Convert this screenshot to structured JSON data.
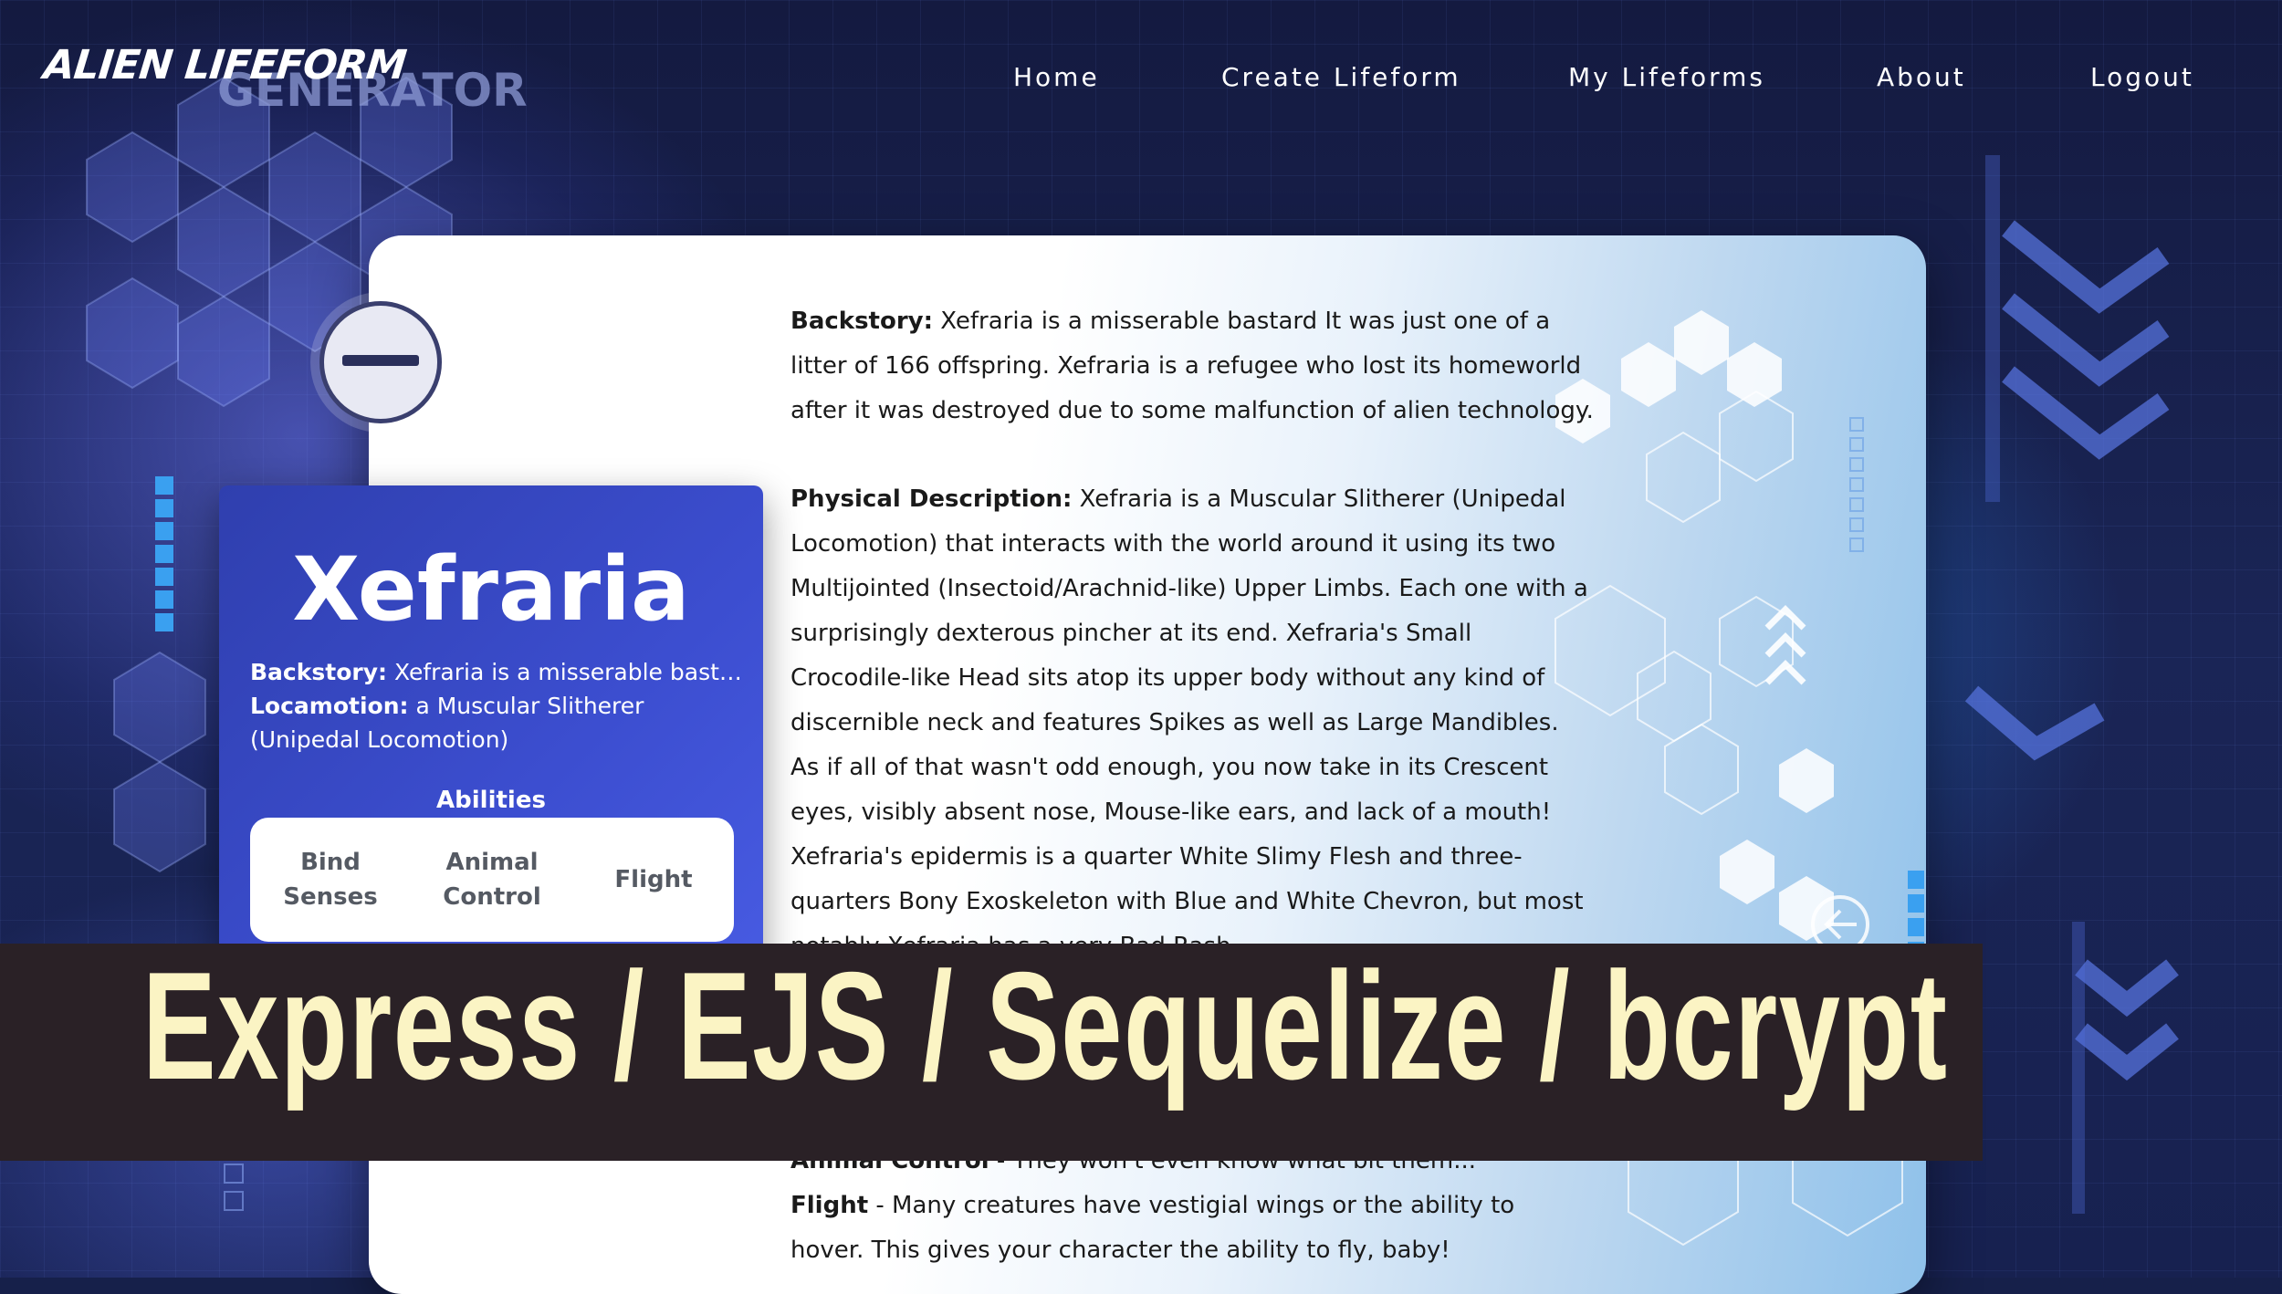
{
  "brand": {
    "line1": "ALIEN LIFEFORM",
    "line2": "GENERATOR"
  },
  "nav": {
    "home": "Home",
    "create": "Create Lifeform",
    "my": "My Lifeforms",
    "about": "About",
    "logout": "Logout"
  },
  "profile": {
    "name": "Xefraria",
    "backstory_label": "Backstory:",
    "backstory_short": "Xefraria is a misserable bastar...",
    "locomotion_label": "Locamotion:",
    "locomotion": "a Muscular Slitherer (Unipedal Locomotion)",
    "abilities_title": "Abilities",
    "abilities": [
      "Bind Senses",
      "Animal Control",
      "Flight"
    ]
  },
  "details": {
    "backstory_label": "Backstory:",
    "backstory": "Xefraria is a misserable bastard It was just one of a litter of 166 offspring. Xefraria is a refugee who lost its homeworld after it was destroyed due to some malfunction of alien technology.",
    "physical_label": "Physical Description:",
    "physical": "Xefraria is a Muscular Slitherer (Unipedal Locomotion) that interacts with the world around it using its two Multijointed (Insectoid/Arachnid-like) Upper Limbs. Each one with a surprisingly dexterous pincher at its end. Xefraria's Small Crocodile-like Head sits atop its upper body without any kind of discernible neck and features Spikes as well as Large Mandibles. As if all of that wasn't odd enough, you now take in its Crescent eyes, visibly absent nose, Mouse-like ears, and lack of a mouth! Xefraria's epidermis is a quarter White Slimy Flesh and three-quarters Bony Exoskeleton with Blue and White Chevron, but most notably Xefraria has a very Bad Rash.",
    "animal_label": "Animal Control",
    "animal": " - They won't even know what bit them...",
    "flight_label": "Flight",
    "flight": " - Many creatures have vestigial wings or the ability to hover. This gives your character the ability to fly, baby!"
  },
  "banner": {
    "text": "Express / EJS / Sequelize / bcrypt"
  },
  "colors": {
    "background": "#16204a",
    "profile_card": "#3c4ed0",
    "banner_bg": "#2a2126",
    "banner_text": "#fbf4c4",
    "accent_blue": "#3aa0f0"
  },
  "icons": [
    "circle-minus-icon",
    "arrow-left-circle-icon",
    "chevron-up-icon"
  ]
}
